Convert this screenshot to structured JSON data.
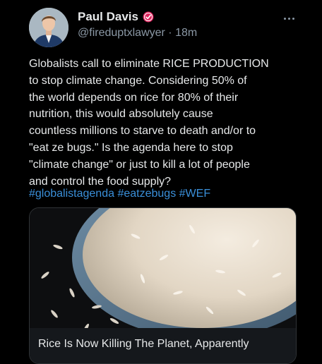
{
  "author": {
    "name": "Paul Davis",
    "handle": "@fireduptxlawyer",
    "separator": "·",
    "time": "18m"
  },
  "tweet": {
    "lines": [
      "Globalists call to eliminate RICE PRODUCTION",
      "to stop climate change. Considering 50% of",
      "the world depends on rice for 80% of their",
      "nutrition, this would absolutely cause",
      "countless millions to starve to death and/or to",
      "\"eat ze bugs.\" Is the agenda here to stop",
      "\"climate change\" or just to kill a lot of people",
      "and control the food supply?"
    ],
    "hashtags": [
      "#globalistagenda",
      "#eatzebugs",
      "#WEF"
    ]
  },
  "card": {
    "title": "Rice Is Now Killing The Planet, Apparently"
  },
  "colors": {
    "background": "#000000",
    "text": "#e7e9ea",
    "secondary": "#8b98a5",
    "link": "#3a8fd9",
    "verified_badge": "#e0245e"
  },
  "icons": {
    "verified": "verified-badge-icon",
    "more": "more-options-icon"
  }
}
